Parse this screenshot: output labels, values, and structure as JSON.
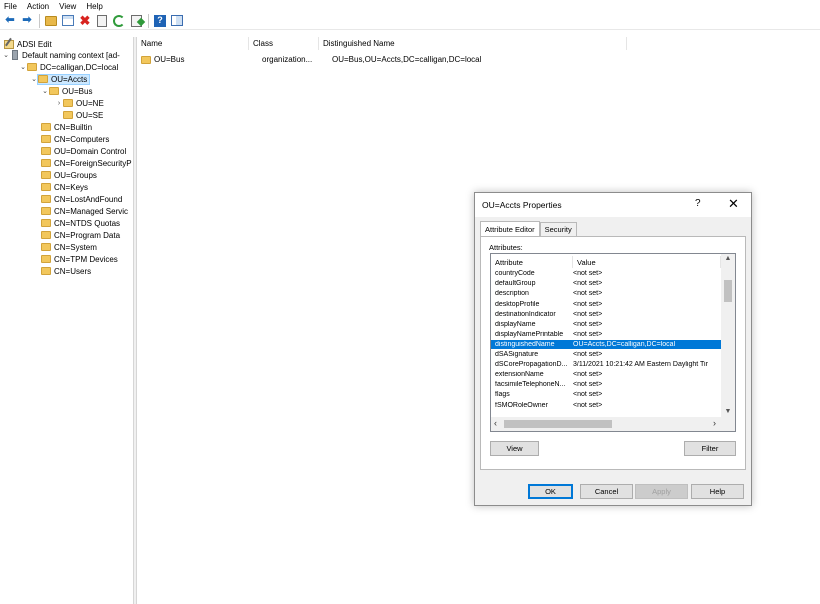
{
  "menu": [
    "File",
    "Action",
    "View",
    "Help"
  ],
  "toolbar": {
    "icons": [
      "back-arrow-icon",
      "forward-arrow-icon",
      "up-folder-icon",
      "show-hide-tree-icon",
      "delete-icon",
      "properties-icon",
      "refresh-icon",
      "export-list-icon",
      "help-icon",
      "action-pane-icon"
    ]
  },
  "tree": {
    "root": "ADSI Edit",
    "context": "Default naming context [ad-",
    "domain": "DC=calligan,DC=local",
    "accts": "OU=Accts",
    "bus": "OU=Bus",
    "ne": "OU=NE",
    "se": "OU=SE",
    "containers": [
      "CN=Builtin",
      "CN=Computers",
      "OU=Domain Control",
      "CN=ForeignSecurityP",
      "OU=Groups",
      "CN=Keys",
      "CN=LostAndFound",
      "CN=Managed Servic",
      "CN=NTDS Quotas",
      "CN=Program Data",
      "CN=System",
      "CN=TPM Devices",
      "CN=Users"
    ]
  },
  "list": {
    "headers": [
      "Name",
      "Class",
      "Distinguished Name"
    ],
    "rows": [
      {
        "name": "OU=Bus",
        "class": "organization...",
        "dn": "OU=Bus,OU=Accts,DC=calligan,DC=local"
      }
    ]
  },
  "dialog": {
    "title": "OU=Accts Properties",
    "help_glyph": "?",
    "close_glyph": "✕",
    "tabs": [
      "Attribute Editor",
      "Security"
    ],
    "attributes_label": "Attributes:",
    "col_attribute": "Attribute",
    "col_value": "Value",
    "rows": [
      {
        "a": "countryCode",
        "v": "<not set>"
      },
      {
        "a": "defaultGroup",
        "v": "<not set>"
      },
      {
        "a": "description",
        "v": "<not set>"
      },
      {
        "a": "desktopProfile",
        "v": "<not set>"
      },
      {
        "a": "destinationIndicator",
        "v": "<not set>"
      },
      {
        "a": "displayName",
        "v": "<not set>"
      },
      {
        "a": "displayNamePrintable",
        "v": "<not set>"
      },
      {
        "a": "distinguishedName",
        "v": "OU=Accts,DC=calligan,DC=local"
      },
      {
        "a": "dSASignature",
        "v": "<not set>"
      },
      {
        "a": "dSCorePropagationD...",
        "v": "3/11/2021 10:21:42 AM Eastern Daylight Tir"
      },
      {
        "a": "extensionName",
        "v": "<not set>"
      },
      {
        "a": "facsimileTelephoneN...",
        "v": "<not set>"
      },
      {
        "a": "flags",
        "v": "<not set>"
      },
      {
        "a": "fSMORoleOwner",
        "v": "<not set>"
      }
    ],
    "selected_index": 7,
    "view_button": "View",
    "filter_button": "Filter",
    "ok": "OK",
    "cancel": "Cancel",
    "apply": "Apply",
    "help": "Help"
  },
  "colors": {
    "selection": "#0078d7",
    "tree_selection": "#cce8ff",
    "folder": "#f2c75c"
  }
}
